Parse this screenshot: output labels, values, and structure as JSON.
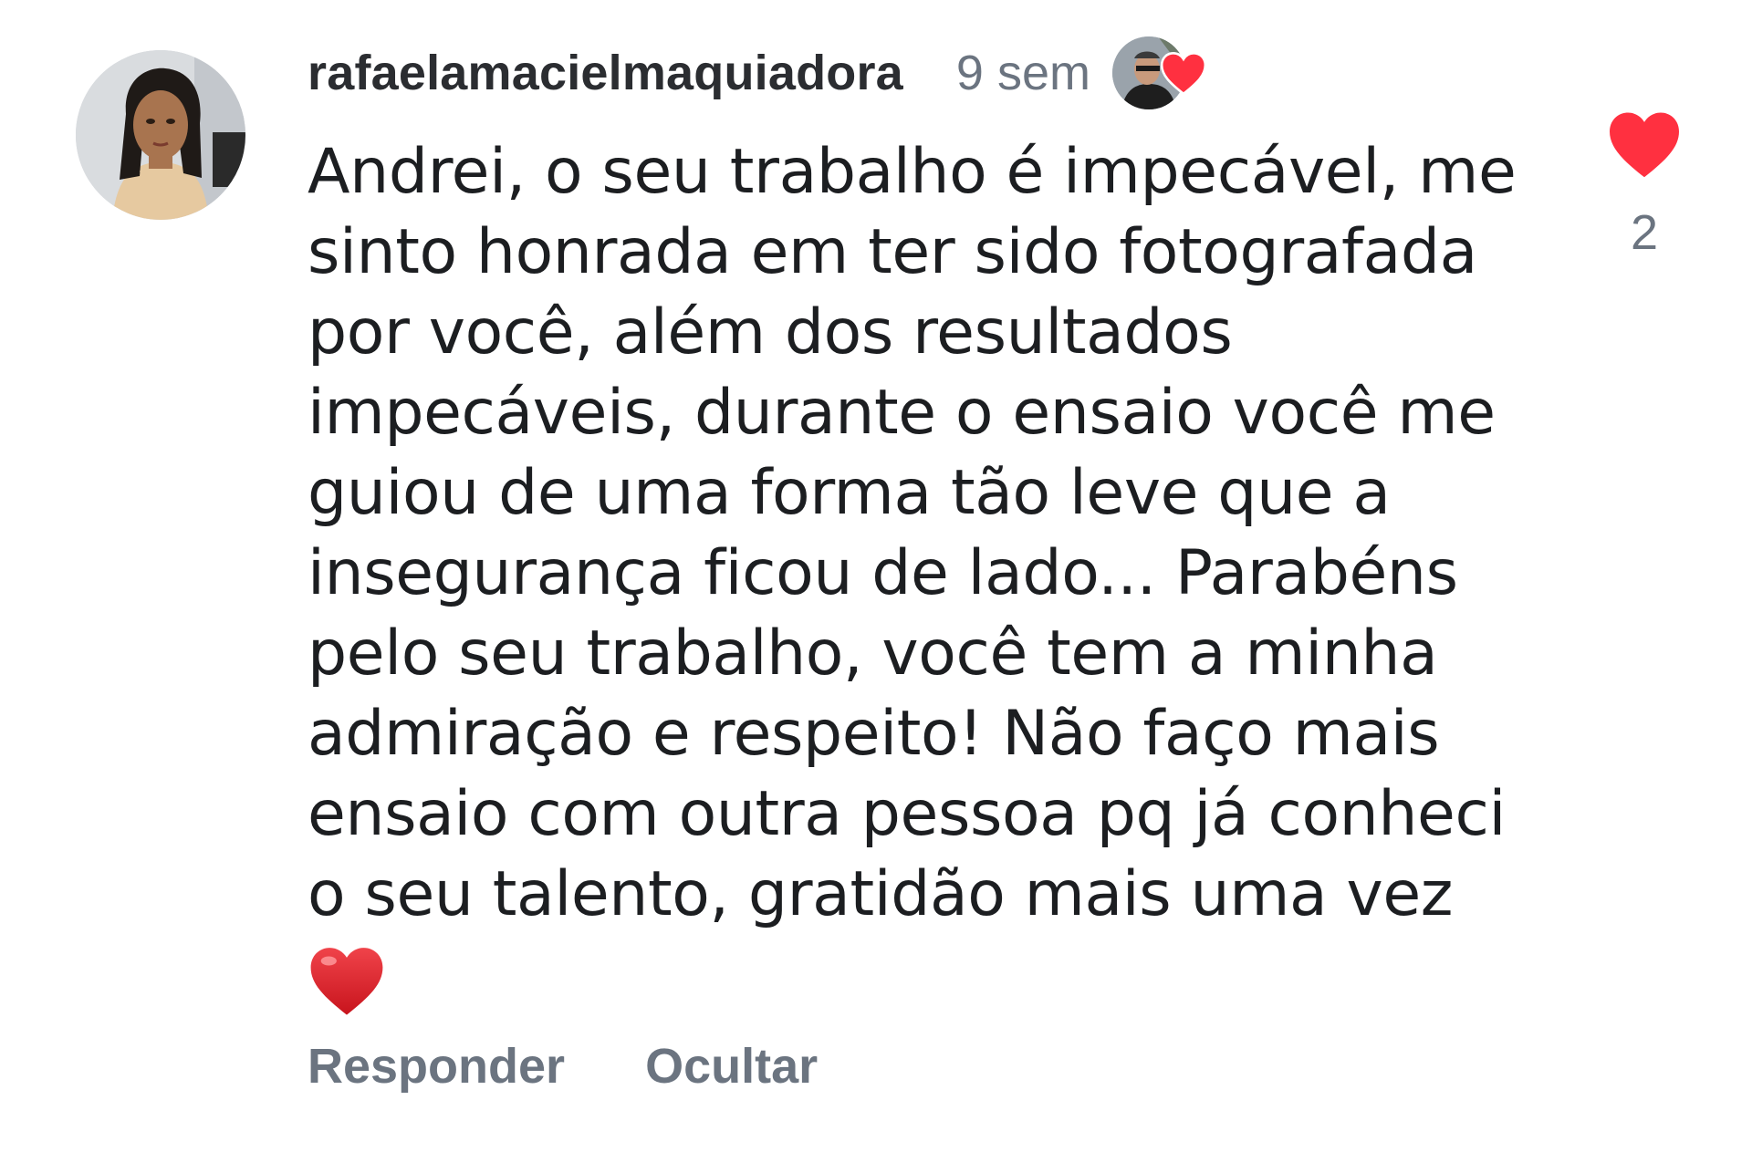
{
  "comment": {
    "username": "rafaelamacielmaquiadora",
    "time": "9 sem",
    "author_liked_icon": "heart-icon",
    "text_lines": [
      "Andrei, o seu trabalho é impecável, me",
      "sinto honrada em ter sido fotografada",
      "por você, além dos resultados",
      "impecáveis, durante o ensaio você me",
      "guiou de uma forma tão leve que a",
      "insegurança ficou de lado... Parabéns",
      "pelo seu trabalho, você tem a minha",
      "admiração e respeito! Não faço mais",
      "ensaio com outra pessoa pq já conheci",
      "o seu talento, gratidão mais uma vez"
    ],
    "emoji": "red-heart-emoji",
    "like_count": "2",
    "actions": {
      "reply": "Responder",
      "hide": "Ocultar"
    }
  },
  "colors": {
    "heart": "#ff3040",
    "muted": "#6b7480",
    "text": "#1c1e21"
  }
}
